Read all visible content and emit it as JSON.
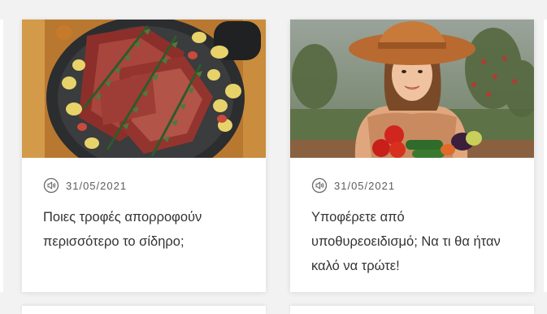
{
  "cards": [
    {
      "image_alt": "Steaks with rosemary and potatoes in a pan",
      "audio_icon": "speaker-icon",
      "date": "31/05/2021",
      "title": "Ποιες τροφές απορροφούν περισσότερο το σίδηρο;"
    },
    {
      "image_alt": "Woman in straw hat with vegetables",
      "audio_icon": "speaker-icon",
      "date": "31/05/2021",
      "title": "Υποφέρετε από υποθυρεοειδισμό; Να τι θα ήταν καλό να τρώτε!"
    }
  ],
  "colors": {
    "page_background": "#f2f2f2",
    "card_background": "#ffffff",
    "title_text": "#333333",
    "date_text": "#5d5d5d"
  }
}
